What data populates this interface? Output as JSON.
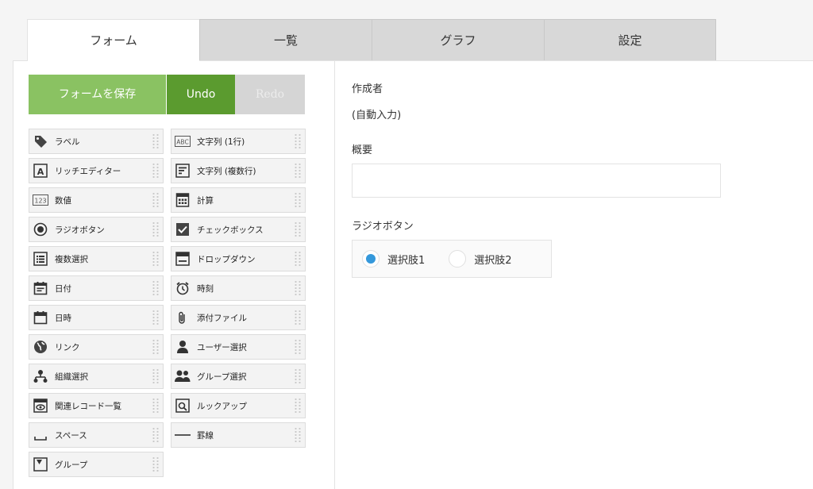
{
  "tabs": [
    {
      "label": "フォーム",
      "active": true
    },
    {
      "label": "一覧",
      "active": false
    },
    {
      "label": "グラフ",
      "active": false
    },
    {
      "label": "設定",
      "active": false
    }
  ],
  "toolbar": {
    "save_label": "フォームを保存",
    "undo_label": "Undo",
    "redo_label": "Redo"
  },
  "palette": {
    "left": [
      {
        "label": "ラベル",
        "icon": "tag-icon"
      },
      {
        "label": "リッチエディター",
        "icon": "rich-editor-icon"
      },
      {
        "label": "数値",
        "icon": "number-icon"
      },
      {
        "label": "ラジオボタン",
        "icon": "radio-icon"
      },
      {
        "label": "複数選択",
        "icon": "multi-select-icon"
      },
      {
        "label": "日付",
        "icon": "calendar-icon"
      },
      {
        "label": "日時",
        "icon": "datetime-icon"
      },
      {
        "label": "リンク",
        "icon": "globe-icon"
      },
      {
        "label": "組織選択",
        "icon": "org-icon"
      },
      {
        "label": "関連レコード一覧",
        "icon": "related-records-icon"
      },
      {
        "label": "スペース",
        "icon": "space-icon"
      },
      {
        "label": "グループ",
        "icon": "group-field-icon"
      }
    ],
    "right": [
      {
        "label": "文字列 (1行)",
        "icon": "abc-icon"
      },
      {
        "label": "文字列 (複数行)",
        "icon": "multiline-text-icon"
      },
      {
        "label": "計算",
        "icon": "calculator-icon"
      },
      {
        "label": "チェックボックス",
        "icon": "checkbox-icon"
      },
      {
        "label": "ドロップダウン",
        "icon": "dropdown-icon"
      },
      {
        "label": "時刻",
        "icon": "clock-icon"
      },
      {
        "label": "添付ファイル",
        "icon": "paperclip-icon"
      },
      {
        "label": "ユーザー選択",
        "icon": "user-icon"
      },
      {
        "label": "グループ選択",
        "icon": "users-icon"
      },
      {
        "label": "ルックアップ",
        "icon": "lookup-icon"
      },
      {
        "label": "罫線",
        "icon": "rule-line-icon"
      }
    ]
  },
  "form": {
    "creator_label": "作成者",
    "creator_value": "(自動入力)",
    "summary_label": "概要",
    "summary_value": "",
    "radio_label": "ラジオボタン",
    "radio_options": [
      {
        "label": "選択肢1",
        "selected": true
      },
      {
        "label": "選択肢2",
        "selected": false
      }
    ]
  },
  "colors": {
    "save": "#8ac262",
    "undo": "#5b9b2f",
    "redo": "#d5d5d5",
    "radio_selected": "#3498db"
  }
}
